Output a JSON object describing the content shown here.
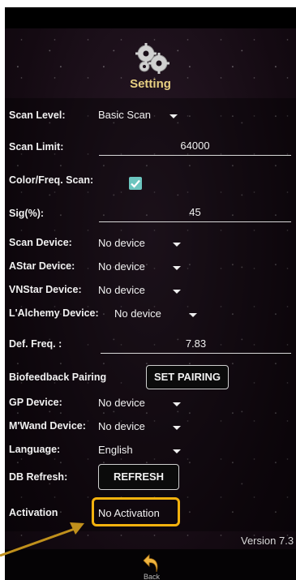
{
  "header": {
    "title": "Setting",
    "icon": "gear-icon"
  },
  "rows": {
    "scan_level": {
      "label": "Scan Level:",
      "value": "Basic Scan"
    },
    "scan_limit": {
      "label": "Scan Limit:",
      "value": "64000"
    },
    "color_freq_scan": {
      "label": "Color/Freq. Scan:",
      "checked": true
    },
    "sig": {
      "label": "Sig(%):",
      "value": "45"
    },
    "scan_device": {
      "label": "Scan Device:",
      "value": "No device"
    },
    "astar_device": {
      "label": "AStar Device:",
      "value": "No device"
    },
    "vnstar_device": {
      "label": "VNStar Device:",
      "value": "No device"
    },
    "lalchemy_device": {
      "label": "L'Alchemy Device:",
      "value": "No device"
    },
    "def_freq": {
      "label": "Def. Freq. :",
      "value": "7.83"
    },
    "biofeedback": {
      "label": "Biofeedback Pairing",
      "button": "SET PAIRING"
    },
    "gp_device": {
      "label": "GP Device:",
      "value": "No device"
    },
    "mwand_device": {
      "label": "M'Wand Device:",
      "value": "No device"
    },
    "language": {
      "label": "Language:",
      "value": "English"
    },
    "db_refresh": {
      "label": "DB Refresh:",
      "button": "REFRESH"
    },
    "activation": {
      "label": "Activation",
      "value": "No Activation"
    }
  },
  "version": "Version 7.3",
  "footer": {
    "back_label": "Back",
    "back_icon": "undo-arrow-icon"
  },
  "colors": {
    "title": "#e7cf82",
    "checkbox": "#6cc5bf",
    "highlight": "#f5b20e",
    "pointer": "#c0901c"
  }
}
